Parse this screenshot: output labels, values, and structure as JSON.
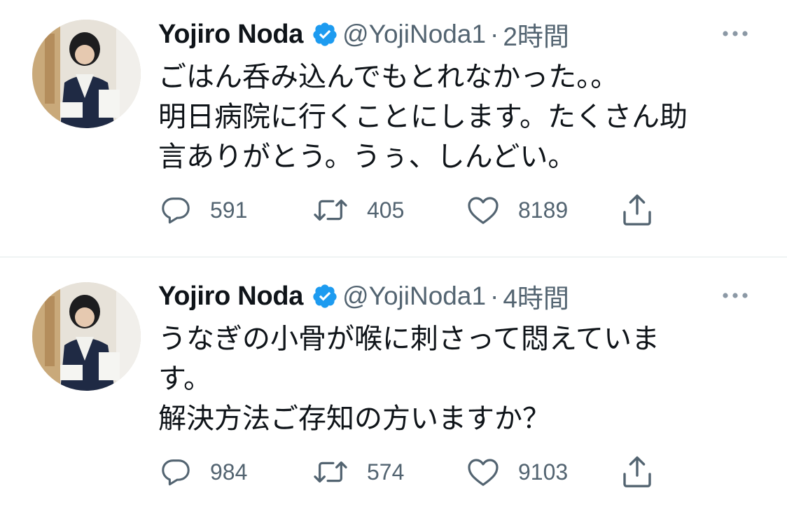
{
  "tweets": [
    {
      "display_name": "Yojiro Noda",
      "handle": "@YojiNoda1",
      "separator": "·",
      "time": "2時間",
      "text_lines": [
        "ごはん呑み込んでもとれなかった。。",
        "明日病院に行くことにします。たくさん助",
        "言ありがとう。うぅ、しんどい。"
      ],
      "replies": "591",
      "retweets": "405",
      "likes": "8189"
    },
    {
      "display_name": "Yojiro Noda",
      "handle": "@YojiNoda1",
      "separator": "·",
      "time": "4時間",
      "text_lines": [
        "うなぎの小骨が喉に刺さって悶えていま",
        "す。",
        "解決方法ご存知の方いますか？"
      ],
      "replies": "984",
      "retweets": "574",
      "likes": "9103"
    }
  ],
  "icons": {
    "verified": "verified-badge-icon",
    "more": "more-horizontal-icon",
    "reply": "reply-bubble-icon",
    "retweet": "retweet-icon",
    "like": "heart-icon",
    "share": "share-upload-icon"
  },
  "colors": {
    "verified_blue": "#1d9bf0",
    "secondary_text": "#536471",
    "primary_text": "#0f1419",
    "divider": "#eff3f4"
  }
}
